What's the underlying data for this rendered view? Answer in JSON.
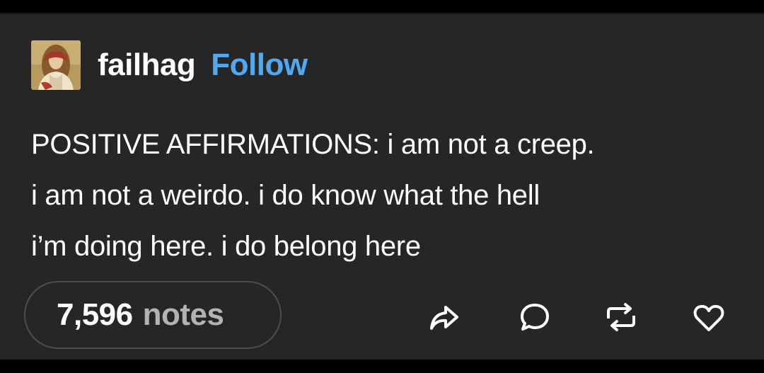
{
  "post": {
    "username": "failhag",
    "follow_label": "Follow",
    "body_lines": [
      "POSITIVE AFFIRMATIONS: i am not a creep.",
      "i am not a weirdo. i do know what the hell",
      "i’m doing here. i do belong here"
    ]
  },
  "notes": {
    "count": "7,596",
    "label": "notes"
  },
  "actions": {
    "icons": [
      "share-icon",
      "reply-icon",
      "reblog-icon",
      "like-icon"
    ]
  },
  "colors": {
    "background": "#262626",
    "text": "#ffffff",
    "follow_accent": "#4fa8f0",
    "muted": "#b3b3b3",
    "pill_border": "#4d4d4d"
  }
}
